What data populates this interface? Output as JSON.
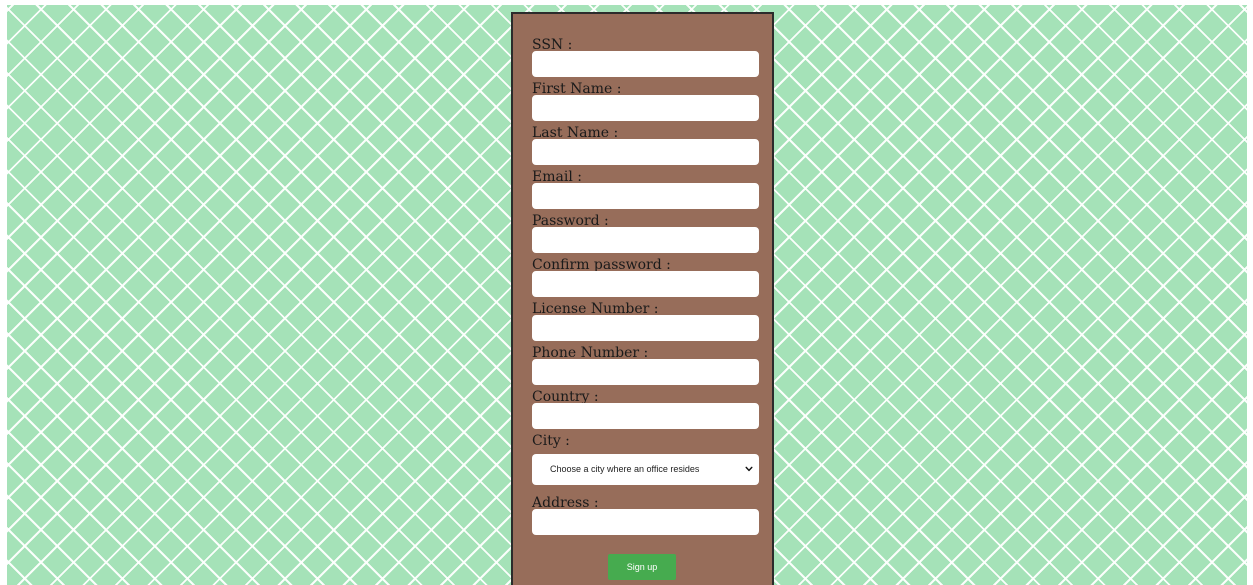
{
  "form": {
    "ssn": {
      "label": "SSN :",
      "value": ""
    },
    "first_name": {
      "label": "First Name :",
      "value": ""
    },
    "last_name": {
      "label": "Last Name :",
      "value": ""
    },
    "email": {
      "label": "Email :",
      "value": ""
    },
    "password": {
      "label": "Password :",
      "value": ""
    },
    "confirm_password": {
      "label": "Confirm password :",
      "value": ""
    },
    "license_number": {
      "label": "License Number :",
      "value": ""
    },
    "phone_number": {
      "label": "Phone Number :",
      "value": ""
    },
    "country": {
      "label": "Country :",
      "value": ""
    },
    "city": {
      "label": "City :",
      "selected": "Choose a city where an office resides"
    },
    "address": {
      "label": "Address :",
      "value": ""
    },
    "submit_label": "Sign up"
  },
  "icons": {
    "select_arrow": "chevron-down-icon"
  },
  "colors": {
    "background": "#a5e2b8",
    "pattern_lines": "#ffffff",
    "card": "#976d5a",
    "card_border": "#2b2b2b",
    "button": "#46ab4f"
  }
}
